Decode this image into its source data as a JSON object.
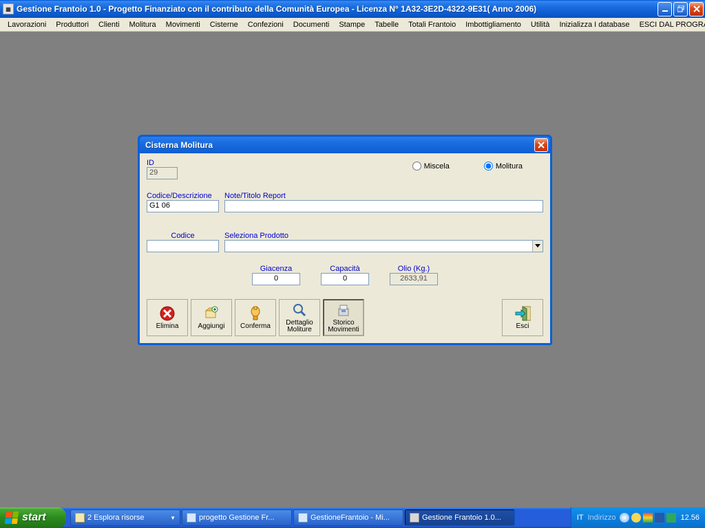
{
  "window": {
    "title": "Gestione Frantoio 1.0 - Progetto Finanziato con il contributo della Comunità Europea - Licenza N° 1A32-3E2D-4322-9E31( Anno 2006)"
  },
  "menu": {
    "items": [
      "Lavorazioni",
      "Produttori",
      "Clienti",
      "Molitura",
      "Movimenti",
      "Cisterne",
      "Confezioni",
      "Documenti",
      "Stampe",
      "Tabelle",
      "Totali Frantoio",
      "Imbottigliamento",
      "Utilità",
      "Inizializza I database",
      "ESCI DAL PROGRAMMA"
    ]
  },
  "dialog": {
    "title": "Cisterna Molitura",
    "labels": {
      "id": "ID",
      "codice_descr": "Codice/Descrizione",
      "note": "Note/Titolo Report",
      "codice": "Codice",
      "seleziona_prodotto": "Seleziona Prodotto",
      "giacenza": "Giacenza",
      "capacita": "Capacità",
      "olio": "Olio (Kg.)"
    },
    "fields": {
      "id": "29",
      "codice_descr": "G1 06",
      "note": "",
      "codice": "",
      "prodotto": "",
      "giacenza": "0",
      "capacita": "0",
      "olio": "2633,91"
    },
    "radio": {
      "miscela": "Miscela",
      "molitura": "Molitura",
      "selected": "molitura"
    },
    "buttons": {
      "elimina": "Elimina",
      "aggiungi": "Aggiungi",
      "conferma": "Conferma",
      "dettaglio": "Dettaglio Moliture",
      "storico": "Storico Movimenti",
      "esci": "Esci"
    }
  },
  "taskbar": {
    "start": "start",
    "items": [
      {
        "label": "2 Esplora risorse",
        "hasArrow": true
      },
      {
        "label": "progetto Gestione Fr..."
      },
      {
        "label": "GestioneFrantoio - Mi..."
      },
      {
        "label": "Gestione Frantoio 1.0...",
        "active": true
      }
    ],
    "lang": "IT",
    "addr": "Indirizzo",
    "clock": "12.56"
  }
}
